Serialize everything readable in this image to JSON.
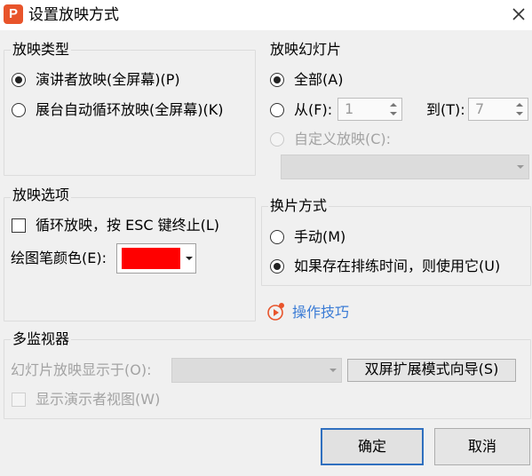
{
  "window": {
    "title": "设置放映方式",
    "logo_letter": "P"
  },
  "show_type": {
    "legend": "放映类型",
    "options": [
      {
        "label": "演讲者放映(全屏幕)(P)",
        "selected": true
      },
      {
        "label": "展台自动循环放映(全屏幕)(K)",
        "selected": false
      }
    ]
  },
  "slides": {
    "legend": "放映幻灯片",
    "all_label": "全部(A)",
    "from_label": "从(F):",
    "from_value": "1",
    "to_label": "到(T):",
    "to_value": "7",
    "custom_label": "自定义放映(C):"
  },
  "options": {
    "legend": "放映选项",
    "loop_label": "循环放映，按 ESC 键终止(L)",
    "pen_label": "绘图笔颜色(E):",
    "pen_color": "#ff0000"
  },
  "advance": {
    "legend": "换片方式",
    "manual_label": "手动(M)",
    "timing_label": "如果存在排练时间，则使用它(U)"
  },
  "tips": {
    "label": "操作技巧",
    "color": "#3a7bd5"
  },
  "monitors": {
    "legend": "多监视器",
    "display_label": "幻灯片放映显示于(O):",
    "wizard_button": "双屏扩展模式向导(S)",
    "presenter_label": "显示演示者视图(W)"
  },
  "footer": {
    "ok_label": "确定",
    "cancel_label": "取消"
  }
}
